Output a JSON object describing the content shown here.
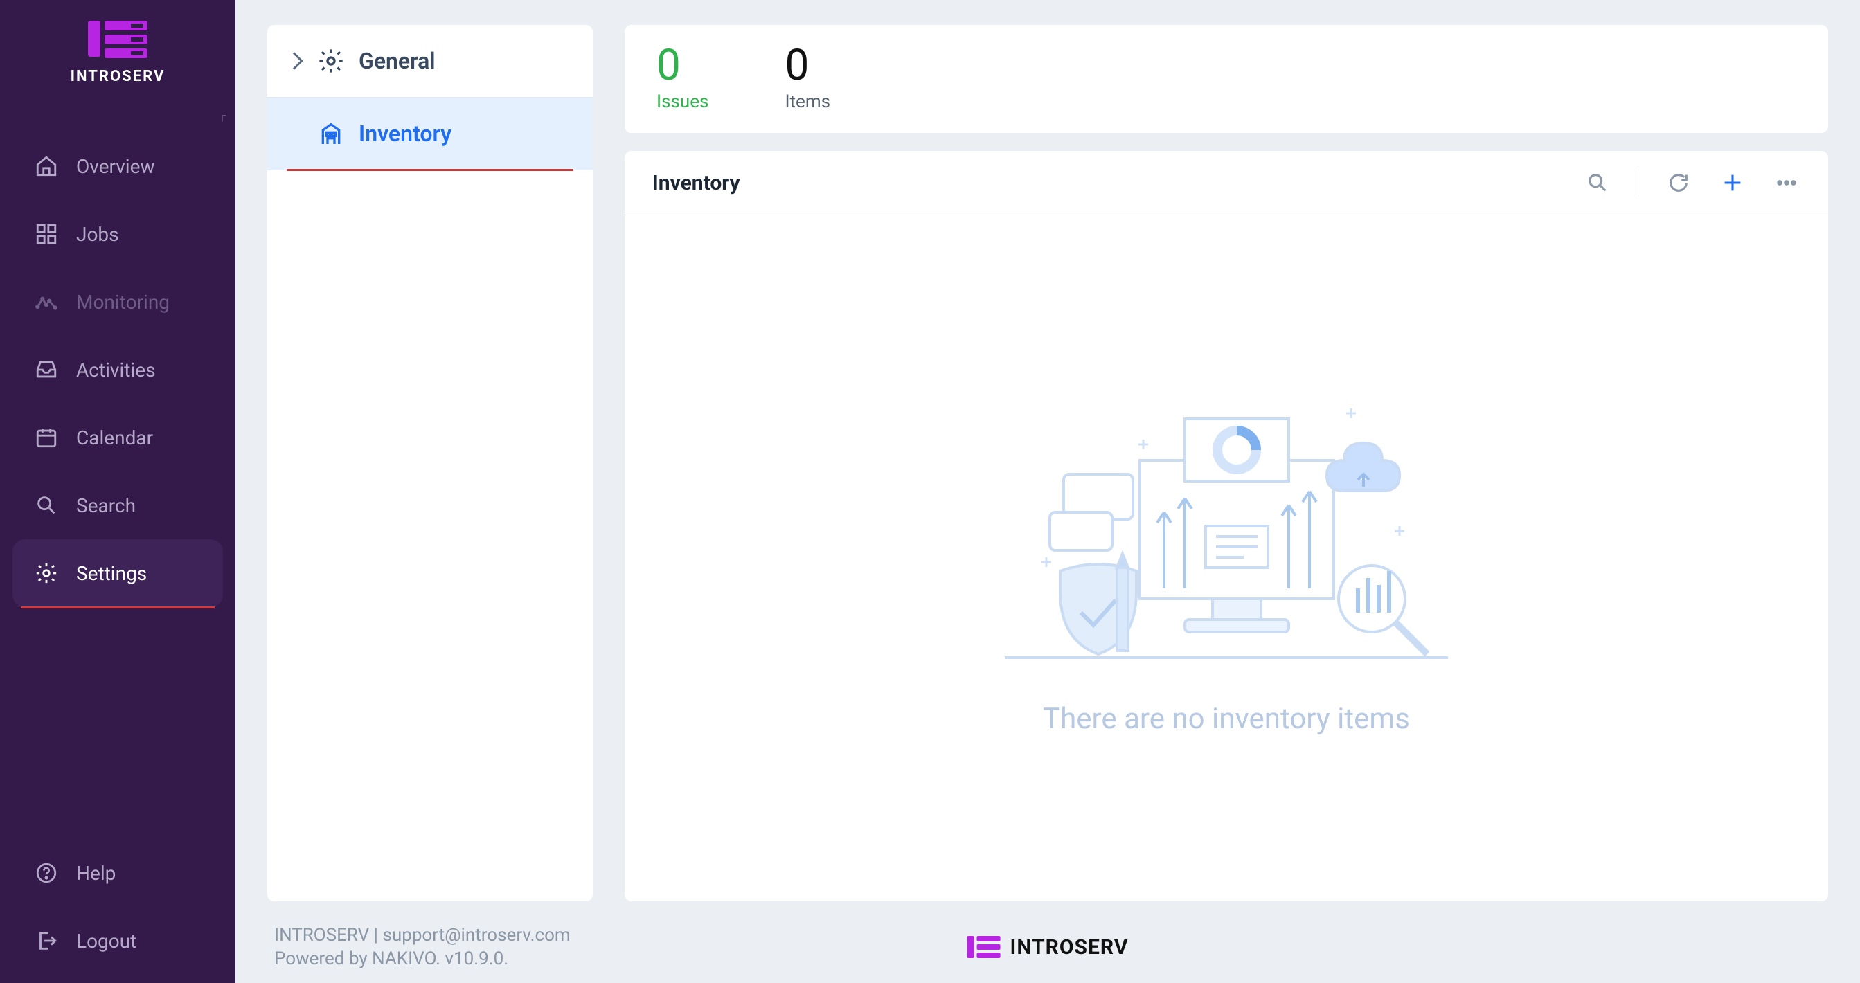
{
  "brand": {
    "name": "INTROSERV"
  },
  "sidebar": {
    "items": [
      {
        "label": "Overview",
        "icon": "home-icon",
        "active": false,
        "dim": false
      },
      {
        "label": "Jobs",
        "icon": "grid-icon",
        "active": false,
        "dim": false
      },
      {
        "label": "Monitoring",
        "icon": "activity-icon",
        "active": false,
        "dim": true
      },
      {
        "label": "Activities",
        "icon": "inbox-icon",
        "active": false,
        "dim": false
      },
      {
        "label": "Calendar",
        "icon": "calendar-icon",
        "active": false,
        "dim": false
      },
      {
        "label": "Search",
        "icon": "search-icon",
        "active": false,
        "dim": false
      },
      {
        "label": "Settings",
        "icon": "gear-icon",
        "active": true,
        "dim": false
      }
    ],
    "bottom": [
      {
        "label": "Help",
        "icon": "help-icon"
      },
      {
        "label": "Logout",
        "icon": "logout-icon"
      }
    ]
  },
  "tree": {
    "items": [
      {
        "label": "General",
        "icon": "gear-icon",
        "expandable": true,
        "active": false
      },
      {
        "label": "Inventory",
        "icon": "building-icon",
        "expandable": false,
        "active": true
      }
    ]
  },
  "stats": {
    "issues": {
      "value": "0",
      "label": "Issues"
    },
    "items": {
      "value": "0",
      "label": "Items"
    }
  },
  "inventory": {
    "title": "Inventory",
    "empty_message": "There are no inventory items"
  },
  "footer": {
    "line1": "INTROSERV | support@introserv.com",
    "line2": "Powered by NAKIVO. v10.9.0.",
    "brand": "INTROSERV"
  }
}
